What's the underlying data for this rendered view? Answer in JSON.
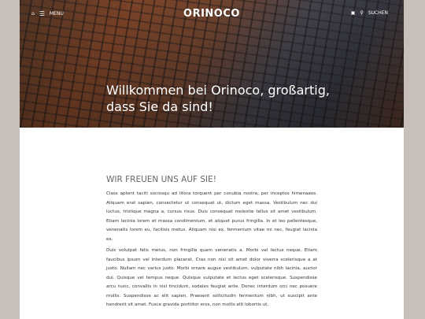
{
  "nav": {
    "home_icon": "home-icon",
    "menu_icon": "hamburger-icon",
    "menu_label": "MENU",
    "logo": "ORINOCO",
    "cart_icon": "cart-icon",
    "search_icon": "search-icon",
    "search_label": "SUCHEN"
  },
  "hero": {
    "title_line1": "Willkommen bei Orinoco, großartig,",
    "title_line2": "dass Sie da sind!"
  },
  "main": {
    "heading": "WIR FREUEN UNS AUF SIE!",
    "paragraphs": [
      "Class aptent taciti sociosqu ad litora torquent per conubia nostra, per inceptos himenaeos. Aliquam erat sapien, consectetur ut consequat ut, dictum eget massa. Vestibulum nec dui luctus, tristique magna a, cursus risus. Duis consequat molestie tellus sit amet vestibulum. Etiam lacinia lorem et massa condimentum, et aliquet purus fringilla. In et leo pellentesque, venenatis lorem eu, facilisis metus. Aliquam nisi ex, fermentum vitae mi nec, feugiat lacinia ex.",
      "Duis volutpat felis metus, non fringilla quam venenatis a. Morbi vel lectus neque. Etiam faucibus ipsum vel interdum placerat. Cras non nisi sit amet dolor viverra scelerisque a at justo. Nullam nec varius justo. Morbi ornare augue vestibulum, vulputate nibh lacinia, auctor dui. Quisque vel tempus neque. Quisque vulputate et lectus eget scelerisque. Suspendisse arcu nunc, convallis in nisl tincidunt, sodales feugiat ante. Donec interdum orci nec posuere mollis. Suspendisse ac elit sapien. Praesent sollicitudin fermentum nibh, ut suscipit ante hendrerit sit amet. Fusce gravida porttitor eros, non mollis elit lobortis ut."
    ]
  }
}
